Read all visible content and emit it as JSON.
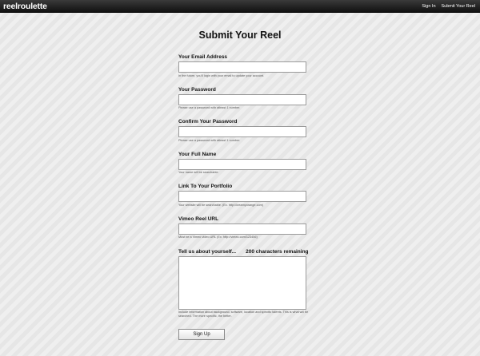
{
  "header": {
    "logo": "reelroulette",
    "nav": {
      "sign_in": "Sign In",
      "submit_reel": "Submit Your Reel"
    }
  },
  "page": {
    "title": "Submit Your Reel"
  },
  "form": {
    "email": {
      "label": "Your Email Address",
      "value": "",
      "help": "In the future, you'll login with your email to update your account."
    },
    "password": {
      "label": "Your Password",
      "value": "",
      "help": "Please use a password with atleast 1 number."
    },
    "confirm_password": {
      "label": "Confirm Your Password",
      "value": "",
      "help": "Please use a password with atleast 1 number."
    },
    "full_name": {
      "label": "Your Full Name",
      "value": "",
      "help": "Your name will be searchable."
    },
    "portfolio": {
      "label": "Link To Your Portfolio",
      "value": "",
      "help": "Your website will be searchable. (Ex. http://creamyorange.com)"
    },
    "vimeo": {
      "label": "Vimeo Reel URL",
      "value": "",
      "help": "Must be a Vimeo video URL (Ex. http://vimeo.com/123456)"
    },
    "about": {
      "label": "Tell us about yourself...",
      "counter": "200 characters remaining",
      "value": "",
      "help": "Include information about background, software, location and specific talents. This is what will be searched. The more specific, the better."
    },
    "submit_label": "Sign Up"
  },
  "colors": {
    "topbar": "#1a1a1a",
    "background": "#ececec",
    "input_border": "#9a9a9a"
  }
}
